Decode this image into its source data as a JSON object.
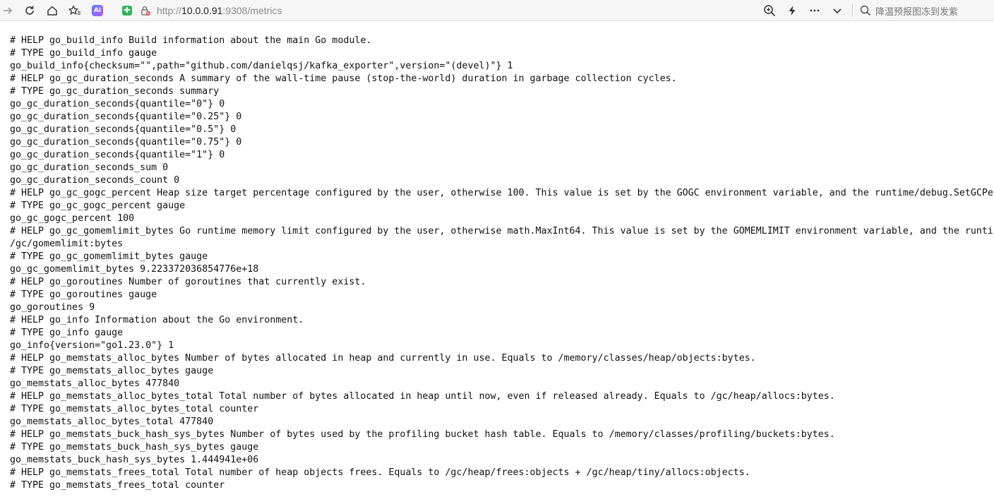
{
  "browser": {
    "url_scheme": "http://",
    "url_host": "10.0.0.91",
    "url_rest": ":9308/metrics",
    "search_placeholder": "降温预报图冻到发紫",
    "ai_label": "AI",
    "shield_label": "✚"
  },
  "metrics_lines": [
    "# HELP go_build_info Build information about the main Go module.",
    "# TYPE go_build_info gauge",
    "go_build_info{checksum=\"\",path=\"github.com/danielqsj/kafka_exporter\",version=\"(devel)\"} 1",
    "# HELP go_gc_duration_seconds A summary of the wall-time pause (stop-the-world) duration in garbage collection cycles.",
    "# TYPE go_gc_duration_seconds summary",
    "go_gc_duration_seconds{quantile=\"0\"} 0",
    "go_gc_duration_seconds{quantile=\"0.25\"} 0",
    "go_gc_duration_seconds{quantile=\"0.5\"} 0",
    "go_gc_duration_seconds{quantile=\"0.75\"} 0",
    "go_gc_duration_seconds{quantile=\"1\"} 0",
    "go_gc_duration_seconds_sum 0",
    "go_gc_duration_seconds_count 0",
    "# HELP go_gc_gogc_percent Heap size target percentage configured by the user, otherwise 100. This value is set by the GOGC environment variable, and the runtime/debug.SetGCPe",
    "# TYPE go_gc_gogc_percent gauge",
    "go_gc_gogc_percent 100",
    "# HELP go_gc_gomemlimit_bytes Go runtime memory limit configured by the user, otherwise math.MaxInt64. This value is set by the GOMEMLIMIT environment variable, and the runtin",
    "/gc/gomemlimit:bytes",
    "# TYPE go_gc_gomemlimit_bytes gauge",
    "go_gc_gomemlimit_bytes 9.223372036854776e+18",
    "# HELP go_goroutines Number of goroutines that currently exist.",
    "# TYPE go_goroutines gauge",
    "go_goroutines 9",
    "# HELP go_info Information about the Go environment.",
    "# TYPE go_info gauge",
    "go_info{version=\"go1.23.0\"} 1",
    "# HELP go_memstats_alloc_bytes Number of bytes allocated in heap and currently in use. Equals to /memory/classes/heap/objects:bytes.",
    "# TYPE go_memstats_alloc_bytes gauge",
    "go_memstats_alloc_bytes 477840",
    "# HELP go_memstats_alloc_bytes_total Total number of bytes allocated in heap until now, even if released already. Equals to /gc/heap/allocs:bytes.",
    "# TYPE go_memstats_alloc_bytes_total counter",
    "go_memstats_alloc_bytes_total 477840",
    "# HELP go_memstats_buck_hash_sys_bytes Number of bytes used by the profiling bucket hash table. Equals to /memory/classes/profiling/buckets:bytes.",
    "# TYPE go_memstats_buck_hash_sys_bytes gauge",
    "go_memstats_buck_hash_sys_bytes 1.444941e+06",
    "# HELP go_memstats_frees_total Total number of heap objects frees. Equals to /gc/heap/frees:objects + /gc/heap/tiny/allocs:objects.",
    "# TYPE go_memstats_frees_total counter"
  ]
}
